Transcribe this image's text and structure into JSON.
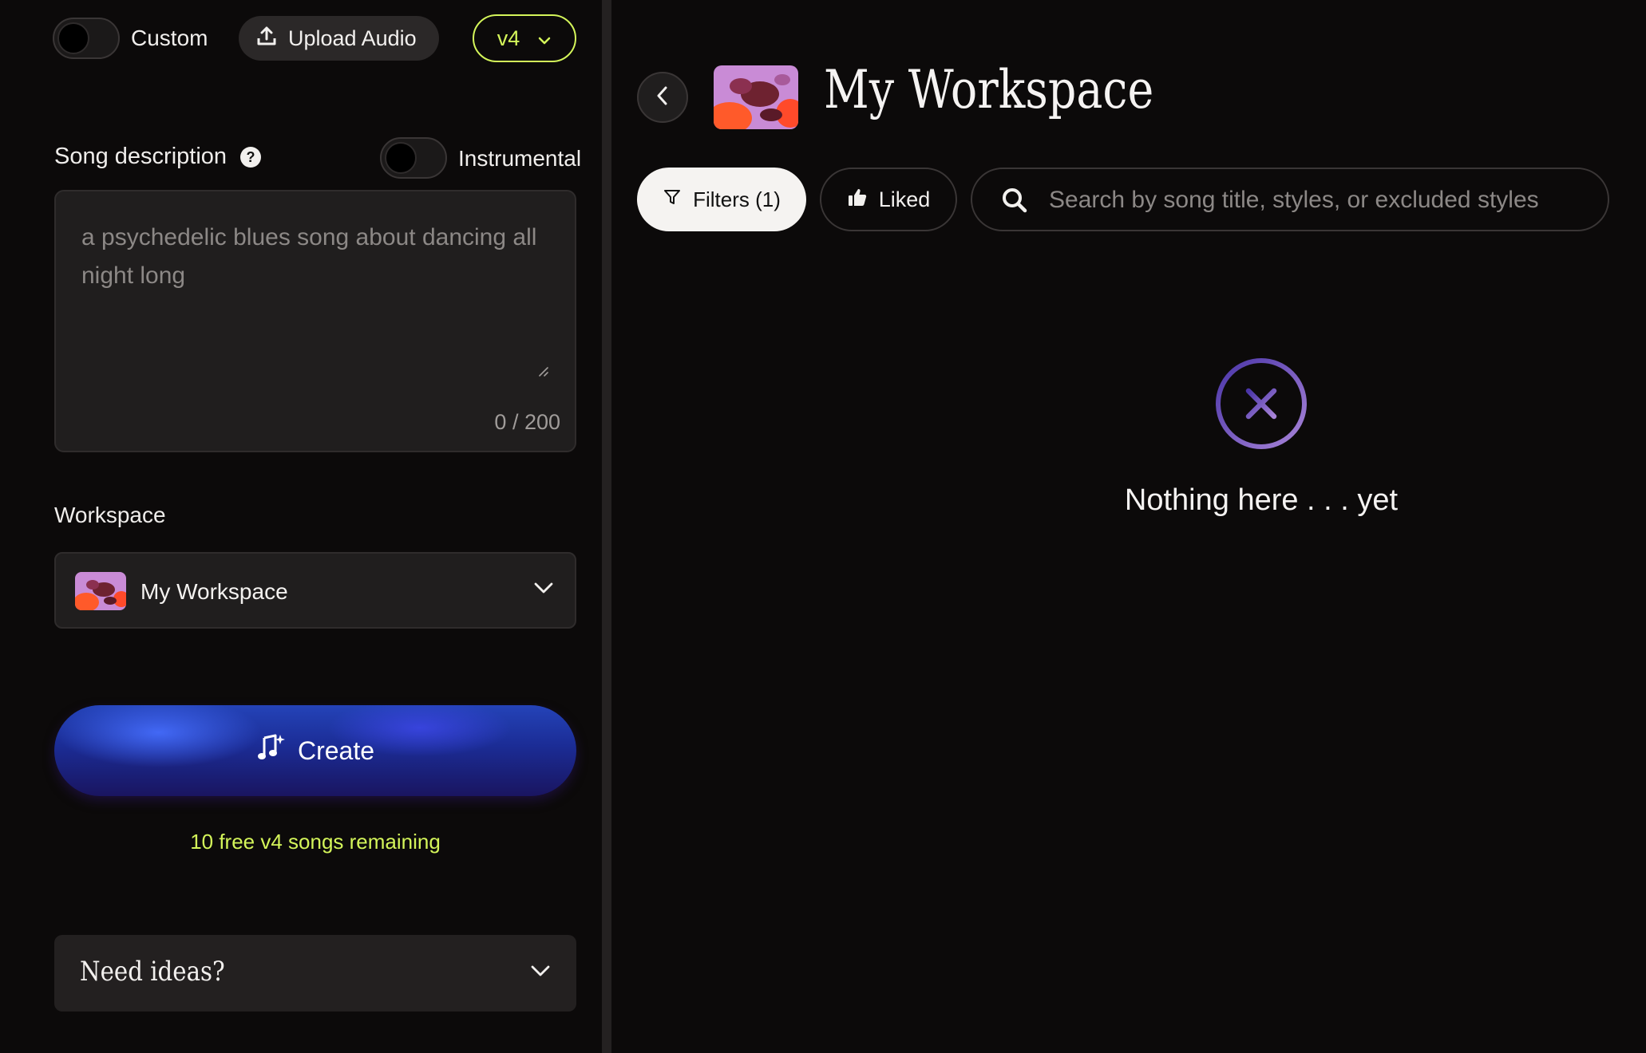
{
  "top_bar": {
    "custom_label": "Custom",
    "upload_label": "Upload Audio",
    "version_label": "v4"
  },
  "song": {
    "description_label": "Song description",
    "instrumental_label": "Instrumental",
    "description_placeholder": "a psychedelic blues song about dancing all night long",
    "char_count": "0 / 200"
  },
  "workspace": {
    "label": "Workspace",
    "selected": "My Workspace"
  },
  "create": {
    "label": "Create",
    "free_songs": "10 free v4 songs remaining"
  },
  "ideas": {
    "label": "Need ideas?"
  },
  "right": {
    "title": "My Workspace",
    "filters_label": "Filters (1)",
    "liked_label": "Liked",
    "search_placeholder": "Search by song title, styles, or excluded styles",
    "empty_text": "Nothing here . . . yet"
  },
  "colors": {
    "accent_lime": "#d4f55a",
    "background": "#0c0a0a",
    "empty_icon": "#7b5ec6"
  },
  "icons": [
    "upload-icon",
    "chevron-down-icon",
    "help-icon",
    "resize-icon",
    "music-sparkle-icon",
    "chevron-left-icon",
    "filter-icon",
    "thumbs-up-icon",
    "search-icon",
    "close-circle-icon"
  ]
}
